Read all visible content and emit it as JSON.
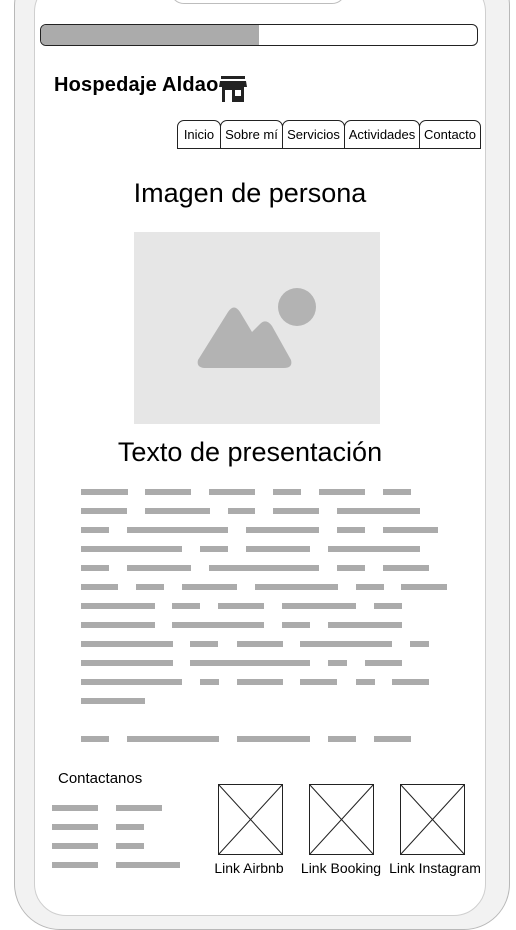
{
  "progress": {
    "percent": 50
  },
  "brand": {
    "name": "Hospedaje Aldao",
    "icon": "storefront-icon"
  },
  "nav": {
    "tabs": [
      {
        "label": "Inicio"
      },
      {
        "label": "Sobre mí"
      },
      {
        "label": "Servicios"
      },
      {
        "label": "Actividades"
      },
      {
        "label": "Contacto"
      }
    ]
  },
  "main": {
    "person_heading": "Imagen de persona",
    "image_placeholder_icon": "image-placeholder-icon",
    "presentation_heading": "Texto de presentación"
  },
  "contact": {
    "title": "Contactanos"
  },
  "social_links": [
    {
      "label": "Link Airbnb"
    },
    {
      "label": "Link Booking"
    },
    {
      "label": "Link Instagram"
    }
  ],
  "colors": {
    "placeholder_line": "#ababab",
    "image_bg": "#e6e6e6",
    "image_glyph": "#b3b3b3"
  }
}
